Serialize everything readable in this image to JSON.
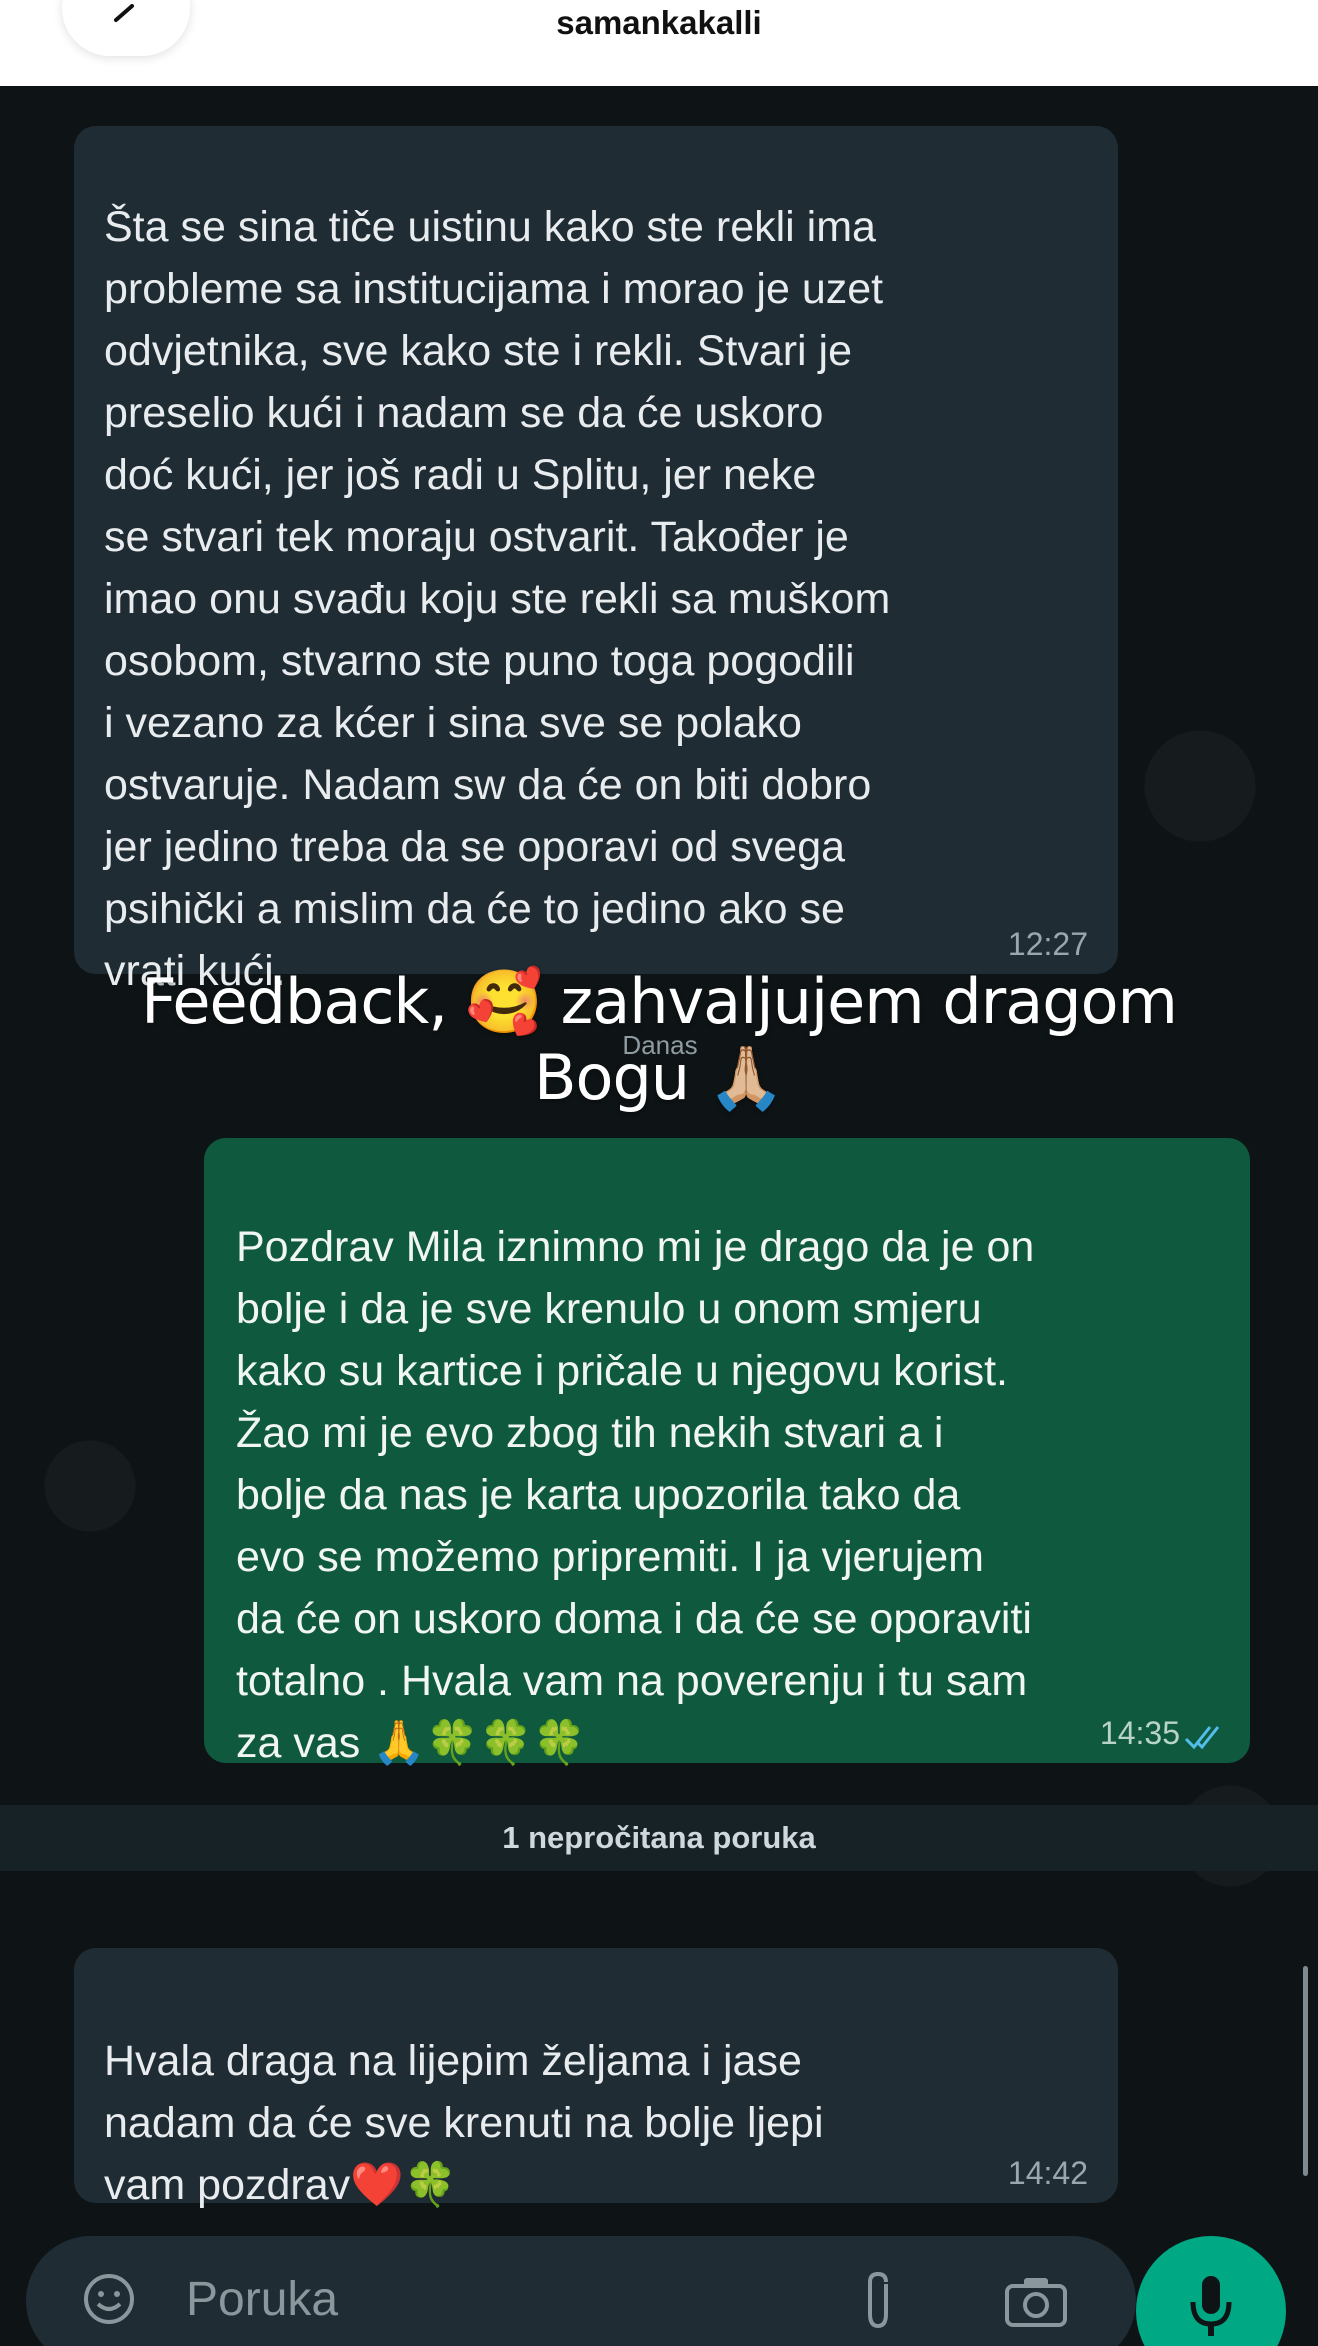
{
  "header": {
    "username": "samankakalli"
  },
  "messages": [
    {
      "direction": "incoming",
      "text": "Šta se sina tiče uistinu kako ste rekli ima\nprobleme sa institucijama i morao je uzet\nodvjetnika, sve kako ste i rekli. Stvari je\npreselio kući  i nadam se da će uskoro\ndoć kući, jer još radi u Splitu, jer neke\nse stvari tek moraju ostvarit. Također je\nimao onu svađu koju ste rekli sa muškom\nosobom, stvarno ste puno toga pogodili\ni vezano za kćer i sina sve se polako\nostvaruje. Nadam sw da će on biti dobro\njer jedino treba da se oporavi od svega\npsihički a mislim da će to jedino ako se\nvrati kući.",
      "time": "12:27"
    },
    {
      "direction": "outgoing",
      "text": "Pozdrav Mila iznimno mi je drago da je on\nbolje i da je sve krenulo u onom smjeru\nkako su kartice i pričale u njegovu korist.\nŽao mi je evo zbog tih nekih stvari a i\nbolje da nas je karta upozorila tako da\nevo se možemo pripremiti. I ja vjerujem\nda će on uskoro doma i da će se oporaviti\ntotalno . Hvala vam na poverenju i tu sam\nza vas 🙏🍀🍀🍀",
      "time": "14:35",
      "status": "read"
    },
    {
      "direction": "incoming",
      "text": "Hvala draga na lijepim željama  i jase\nnadam da će sve krenuti na bolje ljepi\nvam pozdrav❤️🍀",
      "time": "14:42"
    }
  ],
  "overlay": {
    "caption_line1": "Feedback, 🥰 zahvaljujem dragom",
    "caption_line2": "Bogu 🙏🏼"
  },
  "date_separator": "Danas",
  "unread_banner": "1 nepročitana poruka",
  "composer": {
    "placeholder": "Poruka"
  },
  "colors": {
    "chat_background": "#0e1416",
    "incoming_bubble": "#1f2c33",
    "outgoing_bubble": "#0f5a3f",
    "mic_button": "#00a884",
    "read_ticks": "#53bdeb"
  },
  "icons": [
    "back-arrow-icon",
    "emoji-icon",
    "attach-icon",
    "camera-icon",
    "mic-icon",
    "double-check-icon"
  ]
}
